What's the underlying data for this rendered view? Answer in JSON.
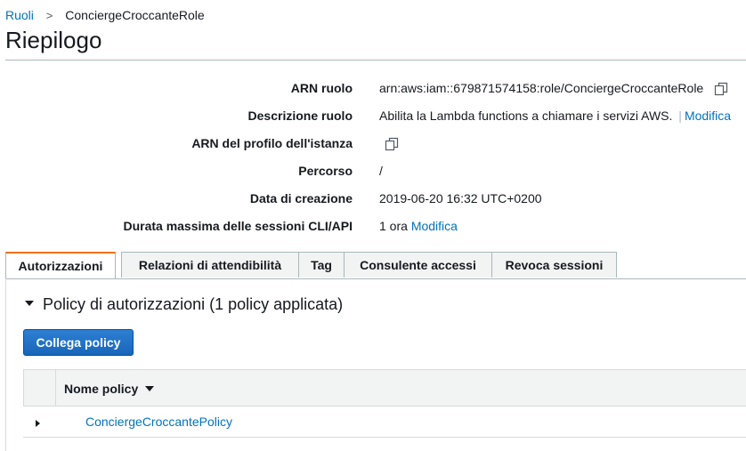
{
  "breadcrumb": {
    "parent": "Ruoli",
    "separator": ">",
    "current": "ConciergeCroccanteRole"
  },
  "page": {
    "title": "Riepilogo"
  },
  "summary": {
    "arn_label": "ARN ruolo",
    "arn_value": "arn:aws:iam::679871574158:role/ConciergeCroccanteRole",
    "description_label": "Descrizione ruolo",
    "description_value": "Abilita la Lambda functions a chiamare i servizi AWS.",
    "description_edit": "Modifica",
    "description_separator": "|",
    "instance_profile_label": "ARN del profilo dell'istanza",
    "path_label": "Percorso",
    "path_value": "/",
    "created_label": "Data di creazione",
    "created_value": "2019-06-20 16:32 UTC+0200",
    "session_label": "Durata massima delle sessioni CLI/API",
    "session_value": "1 ora",
    "session_edit": "Modifica"
  },
  "tabs": [
    {
      "label": "Autorizzazioni",
      "active": true
    },
    {
      "label": "Relazioni di attendibilità",
      "active": false
    },
    {
      "label": "Tag",
      "active": false
    },
    {
      "label": "Consulente accessi",
      "active": false
    },
    {
      "label": "Revoca sessioni",
      "active": false
    }
  ],
  "permissions": {
    "section_title": "Policy di autorizzazioni (1 policy applicata)",
    "attach_button": "Collega policy",
    "column_name": "Nome policy",
    "policies": [
      {
        "name": "ConciergeCroccantePolicy"
      }
    ]
  },
  "colors": {
    "link": "#0073bb",
    "active_tab_accent": "#ec7211",
    "primary_button": "#1866b9"
  },
  "icons": {
    "copy": "copy-icon",
    "section_toggle": "caret-down-icon",
    "sort": "sort-caret-icon",
    "row_expand": "caret-right-icon"
  }
}
